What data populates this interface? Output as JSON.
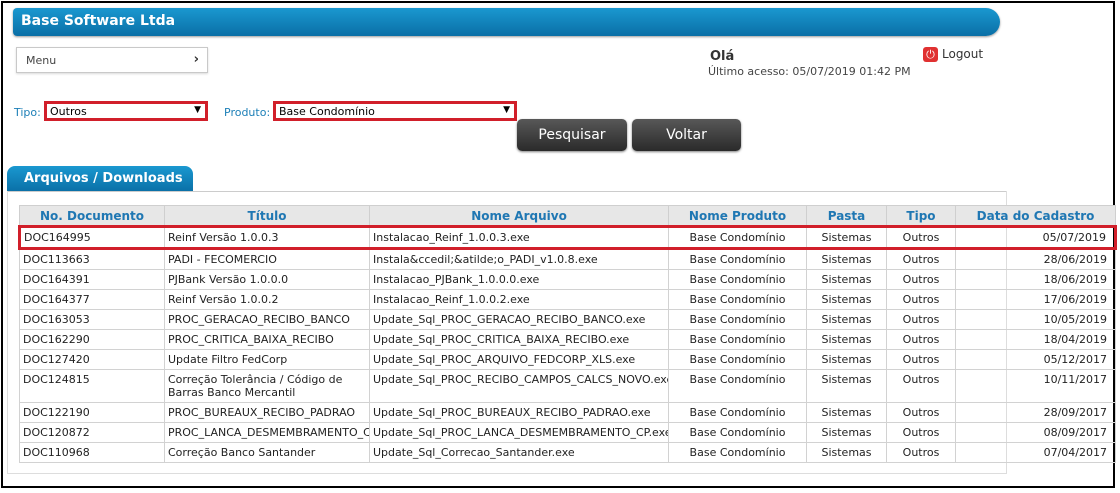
{
  "header": {
    "title": "Base Software Ltda"
  },
  "menu": {
    "label": "Menu",
    "chevron": "›"
  },
  "user": {
    "greeting": "Olá",
    "last_access": "Último acesso: 05/07/2019  01:42 PM",
    "logout_label": "Logout",
    "logout_icon": "power-icon"
  },
  "filters": {
    "tipo_label": "Tipo:",
    "tipo_value": "Outros",
    "produto_label": "Produto:",
    "produto_value": "Base Condomínio",
    "arrow": "▼"
  },
  "buttons": {
    "search": "Pesquisar",
    "back": "Voltar"
  },
  "panel": {
    "title": "Arquivos / Downloads"
  },
  "table": {
    "headers": [
      "No. Documento",
      "Título",
      "Nome Arquivo",
      "Nome Produto",
      "Pasta",
      "Tipo",
      "Data do Cadastro"
    ],
    "rows": [
      [
        "DOC164995",
        "Reinf Versão 1.0.0.3",
        "Instalacao_Reinf_1.0.0.3.exe",
        "Base Condomínio",
        "Sistemas",
        "Outros",
        "05/07/2019"
      ],
      [
        "DOC113663",
        "PADI - FECOMERCIO",
        "Instala&ccedil;&atilde;o_PADI_v1.0.8.exe",
        "Base Condomínio",
        "Sistemas",
        "Outros",
        "28/06/2019"
      ],
      [
        "DOC164391",
        "PJBank Versão 1.0.0.0",
        "Instalacao_PJBank_1.0.0.0.exe",
        "Base Condomínio",
        "Sistemas",
        "Outros",
        "18/06/2019"
      ],
      [
        "DOC164377",
        "Reinf Versão 1.0.0.2",
        "Instalacao_Reinf_1.0.0.2.exe",
        "Base Condomínio",
        "Sistemas",
        "Outros",
        "17/06/2019"
      ],
      [
        "DOC163053",
        "PROC_GERACAO_RECIBO_BANCO",
        "Update_Sql_PROC_GERACAO_RECIBO_BANCO.exe",
        "Base Condomínio",
        "Sistemas",
        "Outros",
        "10/05/2019"
      ],
      [
        "DOC162290",
        "PROC_CRITICA_BAIXA_RECIBO",
        "Update_Sql_PROC_CRITICA_BAIXA_RECIBO.exe",
        "Base Condomínio",
        "Sistemas",
        "Outros",
        "18/04/2019"
      ],
      [
        "DOC127420",
        "Update Filtro FedCorp",
        "Update_Sql_PROC_ARQUIVO_FEDCORP_XLS.exe",
        "Base Condomínio",
        "Sistemas",
        "Outros",
        "05/12/2017"
      ],
      [
        "DOC124815",
        "Correção Tolerância / Código de Barras Banco Mercantil",
        "Update_Sql_PROC_RECIBO_CAMPOS_CALCS_NOVO.exe",
        "Base Condomínio",
        "Sistemas",
        "Outros",
        "10/11/2017"
      ],
      [
        "DOC122190",
        "PROC_BUREAUX_RECIBO_PADRAO",
        "Update_Sql_PROC_BUREAUX_RECIBO_PADRAO.exe",
        "Base Condomínio",
        "Sistemas",
        "Outros",
        "28/09/2017"
      ],
      [
        "DOC120872",
        "PROC_LANCA_DESMEMBRAMENTO_CP",
        "Update_Sql_PROC_LANCA_DESMEMBRAMENTO_CP.exe",
        "Base Condomínio",
        "Sistemas",
        "Outros",
        "08/09/2017"
      ],
      [
        "DOC110968",
        "Correção Banco Santander",
        "Update_Sql_Correcao_Santander.exe",
        "Base Condomínio",
        "Sistemas",
        "Outros",
        "07/04/2017"
      ]
    ]
  },
  "colors": {
    "header_blue": "#0a6fa6",
    "highlight_red": "#d11f2a",
    "label_blue": "#1c7fb7"
  }
}
